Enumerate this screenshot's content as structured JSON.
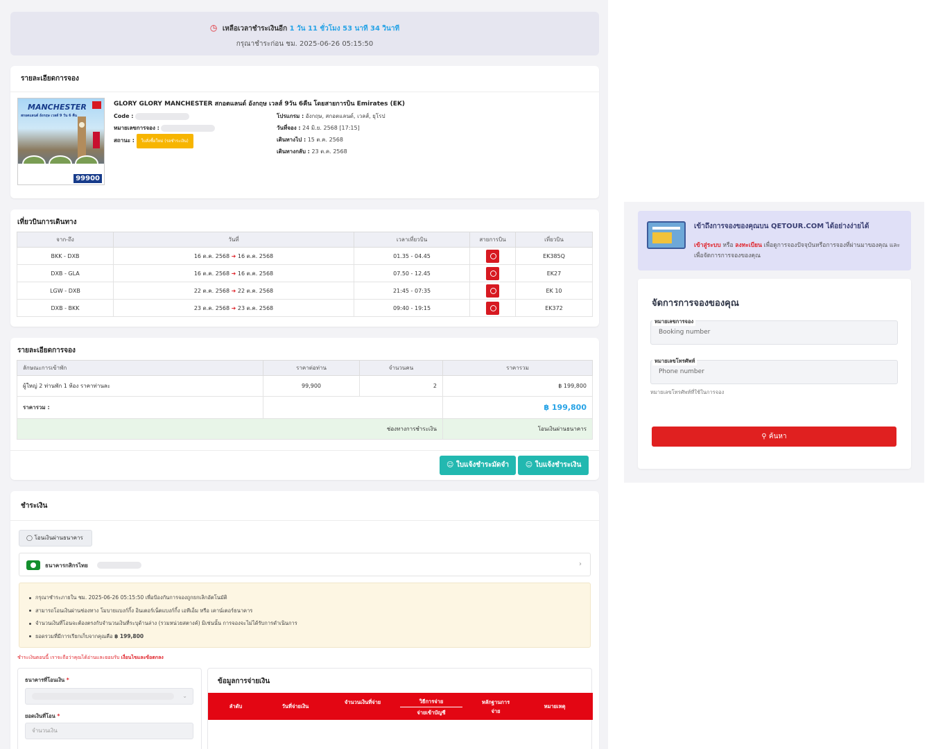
{
  "timer": {
    "icon": "clock-icon",
    "prefix": "เหลือเวลาชำระเงินอีก",
    "remaining": "1 วัน 11 ชั่วโมง 53 นาที 34 วินาที",
    "deadline": "กรุณาชำระก่อน ชม. 2025-06-26 05:15:50"
  },
  "booking": {
    "heading": "รายละเอียดการจอง",
    "thumb": {
      "title": "MANCHESTER",
      "subtitle": "สกอตแลนด์ อังกฤษ เวลส์ 9 วัน 6 คืน",
      "brand": "GLORY GLORY",
      "price": "99900"
    },
    "title": "GLORY GLORY MANCHESTER สกอตแลนด์ อังกฤษ เวลส์ 9วัน 6คืน โดยสายการบิน Emirates (EK)",
    "code_label": "Code :",
    "booking_no_label": "หมายเลขการจอง :",
    "status_label": "สถานะ :",
    "status_value": "ใบสั่งซื้อใหม่ (รอชำระเงิน)",
    "program_label": "โปรแกรม :",
    "program_value": "อังกฤษ, สกอตแลนด์, เวลส์, ยุโรป",
    "booked_label": "วันที่จอง :",
    "booked_value": "24 มิ.ย. 2568 [17:15]",
    "depart_label": "เดินทางไป :",
    "depart_value": "15 ต.ค. 2568",
    "return_label": "เดินทางกลับ :",
    "return_value": "23 ต.ค. 2568"
  },
  "flights": {
    "heading": "เที่ยวบินการเดินทาง",
    "columns": [
      "จาก-ถึง",
      "วันที่",
      "เวลาเที่ยวบิน",
      "สายการบิน",
      "เที่ยวบิน"
    ],
    "rows": [
      {
        "route": "BKK - DXB",
        "from": "16 ต.ค. 2568",
        "to": "16 ต.ค. 2568",
        "time": "01.35 - 04.45",
        "flight": "EK385Q"
      },
      {
        "route": "DXB - GLA",
        "from": "16 ต.ค. 2568",
        "to": "16 ต.ค. 2568",
        "time": "07.50 - 12.45",
        "flight": "EK27"
      },
      {
        "route": "LGW - DXB",
        "from": "22 ต.ค. 2568",
        "to": "22 ต.ค. 2568",
        "time": "21:45 - 07:35",
        "flight": "EK 10"
      },
      {
        "route": "DXB - BKK",
        "from": "23 ต.ค. 2568",
        "to": "23 ต.ค. 2568",
        "time": "09:40 - 19:15",
        "flight": "EK372"
      }
    ]
  },
  "pricing": {
    "heading": "รายละเอียดการจอง",
    "columns": [
      "ลักษณะการเข้าพัก",
      "ราคาต่อท่าน",
      "จำนวนคน",
      "ราคารวม"
    ],
    "row": {
      "desc": "ผู้ใหญ่ 2 ท่านพัก 1 ห้อง ราคาท่านละ",
      "unit": "99,900",
      "qty": "2",
      "total": "฿ 199,800"
    },
    "sum_label": "ราคารวม :",
    "sum_value": "฿ 199,800",
    "channel_label": "ช่องทางการชำระเงิน",
    "channel_value": "โอนเงินผ่านธนาคาร",
    "btn_deposit": "ใบแจ้งชำระมัดจำ",
    "btn_full": "ใบแจ้งชำระเงิน"
  },
  "payment": {
    "heading": "ชำระเงิน",
    "tab": "โอนเงินผ่านธนาคาร",
    "bank_name": "ธนาคารกสิกรไทย",
    "notes": [
      "กรุณาชำระภายใน ชม. 2025-06-26 05:15:50 เพื่อป้องกันการจองถูกยกเลิกอัตโนมัติ",
      "สามารถโอนเงินผ่านช่องทาง โมบายแบงก์กิ้ง อินเตอร์เน็ตแบงก์กิ้ง เอทีเอ็ม หรือ เคาน์เตอร์ธนาคาร",
      "จำนวนเงินที่โอนจะต้องตรงกับจำนวนเงินที่ระบุด้านล่าง (รวมหน่วยสตางค์) มิเช่นนั้น การจองจะไม่ได้รับการดำเนินการ"
    ],
    "total_note_prefix": "ยอดรวมที่มีการเรียกเก็บจากคุณคือ",
    "total_note_value": "฿ 199,800",
    "red_note": "ชำระเงินตอนนี้ เราจะถือว่าคุณได้อ่านและยอมรับ",
    "red_note_link": "เงื่อนไขและข้อตกลง",
    "form_bank_label": "ธนาคารที่โอนเงิน",
    "form_amount_label": "ยอดเงินที่โอน",
    "form_amount_placeholder": "จำนวนเงิน",
    "info_heading": "ข้อมูลการจ่ายเงิน",
    "info_columns": {
      "no": "ลำดับ",
      "date": "วันที่จ่ายเงิน",
      "amount": "จำนวนเงินที่จ่าย",
      "method_top": "วิธีการจ่าย",
      "method_bottom": "จ่ายเข้าบัญชี",
      "proof": "หลักฐานการจ่าย",
      "note": "หมายเหตุ"
    }
  },
  "sidebar": {
    "promo_title": "เข้าถึงการจองของคุณบน QETOUR.COM ได้อย่างง่ายได้",
    "promo_login": "เข้าสู่ระบบ",
    "promo_or": "หรือ",
    "promo_register": "ลงทะเบียน",
    "promo_rest": "เพื่อดูการจองปัจจุบันหรือการจองที่ผ่านมาของคุณ และเพื่อจัดการการจองของคุณ",
    "manage_title": "จัดการการจองของคุณ",
    "booking_label": "หมายเลขการจอง",
    "booking_placeholder": "Booking number",
    "phone_label": "หมายเลขโทรศัพท์",
    "phone_placeholder": "Phone number",
    "phone_hint": "หมายเลขโทรศัพท์ที่ใช้ในการจอง",
    "search_label": "ค้นหา"
  }
}
